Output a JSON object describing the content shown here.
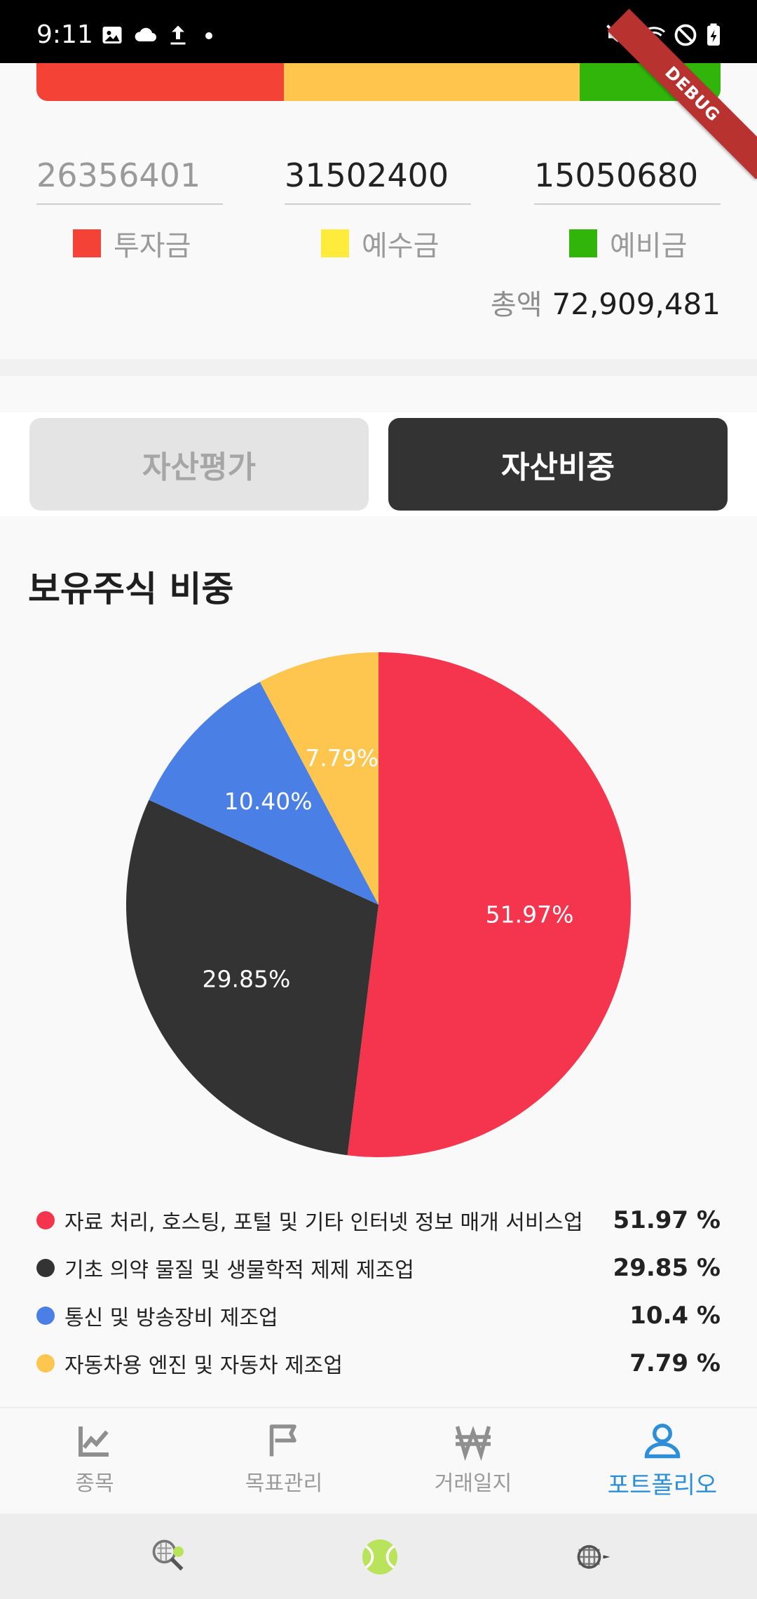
{
  "status_bar": {
    "time": "9:11",
    "left_icons": [
      "image-icon",
      "cloud-icon",
      "upload-icon",
      "dot-icon"
    ],
    "right_icons": [
      "mute-icon",
      "wifi-icon",
      "block-icon",
      "battery-charging-icon"
    ]
  },
  "debug_banner": "DEBUG",
  "allocation_bar": {
    "segments": [
      {
        "name": "투자금",
        "value": 26356401,
        "color": "#f44336"
      },
      {
        "name": "예수금",
        "value": 31502400,
        "color": "#ffc54d"
      },
      {
        "name": "예비금",
        "value": 15050680,
        "color": "#32b50a"
      }
    ]
  },
  "fields": {
    "investment": {
      "value": "26356401",
      "label": "투자금",
      "color": "#f44336"
    },
    "deposit": {
      "value": "31502400",
      "label": "예수금",
      "color": "#ffeb3b"
    },
    "reserve": {
      "value": "15050680",
      "label": "예비금",
      "color": "#32b50a"
    }
  },
  "total": {
    "label": "총액",
    "value": "72,909,481"
  },
  "tabs": {
    "asset_eval": "자산평가",
    "asset_weight": "자산비중"
  },
  "section_title": "보유주식 비중",
  "chart_data": {
    "type": "pie",
    "slices": [
      {
        "name": "자료 처리, 호스팅, 포털 및 기타 인터넷 정보 매개 서비스업",
        "value": 51.97,
        "label": "51.97%",
        "color": "#f5354e"
      },
      {
        "name": "기초 의약 물질 및 생물학적 제제 제조업",
        "value": 29.85,
        "label": "29.85%",
        "color": "#333333"
      },
      {
        "name": "통신 및 방송장비 제조업",
        "value": 10.4,
        "label": "10.40%",
        "color": "#4a7fe6"
      },
      {
        "name": "자동차용 엔진 및 자동차 제조업",
        "value": 7.79,
        "label": "7.79%",
        "color": "#fec54f"
      }
    ]
  },
  "legend": [
    {
      "name": "자료 처리, 호스팅, 포털 및 기타 인터넷 정보 매개 서비스업",
      "pct": "51.97 %",
      "color": "#f5354e"
    },
    {
      "name": "기초 의약 물질 및 생물학적 제제 제조업",
      "pct": "29.85 %",
      "color": "#333333"
    },
    {
      "name": "통신 및 방송장비 제조업",
      "pct": "10.4 %",
      "color": "#4a7fe6"
    },
    {
      "name": "자동차용 엔진 및 자동차 제조업",
      "pct": "7.79 %",
      "color": "#fec54f"
    }
  ],
  "bottom_nav": [
    {
      "label": "종목",
      "icon": "chart-line-icon"
    },
    {
      "label": "목표관리",
      "icon": "flag-icon"
    },
    {
      "label": "거래일지",
      "icon": "won-icon"
    },
    {
      "label": "포트폴리오",
      "icon": "person-icon",
      "selected": true
    }
  ],
  "system_bar": {
    "icons": [
      "tennis-racket-icon",
      "tennis-ball-icon",
      "net-icon"
    ]
  },
  "colors": {
    "accent": "#2d8fd8",
    "active_tab": "#333333",
    "inactive_tab": "#e4e4e4"
  }
}
